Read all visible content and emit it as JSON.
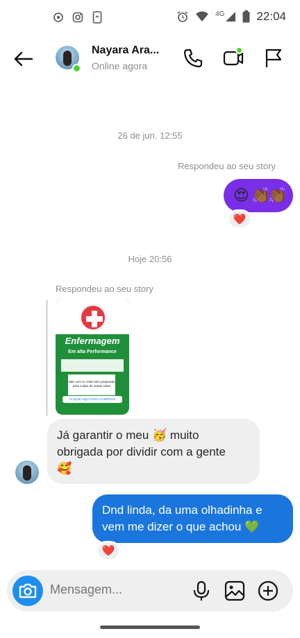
{
  "status_bar": {
    "time": "22:04",
    "network": "4G",
    "icons": [
      "call-recording-icon",
      "instagram-icon",
      "phone-link-icon",
      "alarm-icon",
      "wifi-icon",
      "signal-icon",
      "battery-icon"
    ]
  },
  "header": {
    "back_icon": "arrow-left-icon",
    "name": "Nayara Ara...",
    "status": "Online agora",
    "actions": [
      "phone-icon",
      "video-icon",
      "flag-icon"
    ],
    "online_color": "#4cd42f"
  },
  "messages": {
    "sep1": "26 de jun. 12:55",
    "reply_label_1": "Respondeu ao seu story",
    "out1_emojis": [
      "😍",
      "👏🏾",
      "👏🏾"
    ],
    "out1_color": "#7a2ee8",
    "reaction1": "❤️",
    "sep2": "Hoje 20:56",
    "reply_label_2": "Respondeu ao seu story",
    "story": {
      "title": "Enfermagem",
      "subtitle": "Em alta Performance",
      "card_text": "Vale caro vc estar bem preparado para cuidar de outras vidas",
      "button_text": "CLIQUE AQUI PARA COMPRAR"
    },
    "in1_line1": "Já garantir o meu 🥳 muito",
    "in1_line2": "obrigada por dividir com a gente",
    "in1_line3": "🥰",
    "out2_text": "Dnd linda, da uma olhadinha e vem me dizer o que achou 💚",
    "out2_color": "#1a76dd",
    "reaction2": "❤️"
  },
  "composer": {
    "placeholder": "Mensagem...",
    "icons": [
      "camera-icon",
      "microphone-icon",
      "gallery-icon",
      "add-icon"
    ]
  }
}
